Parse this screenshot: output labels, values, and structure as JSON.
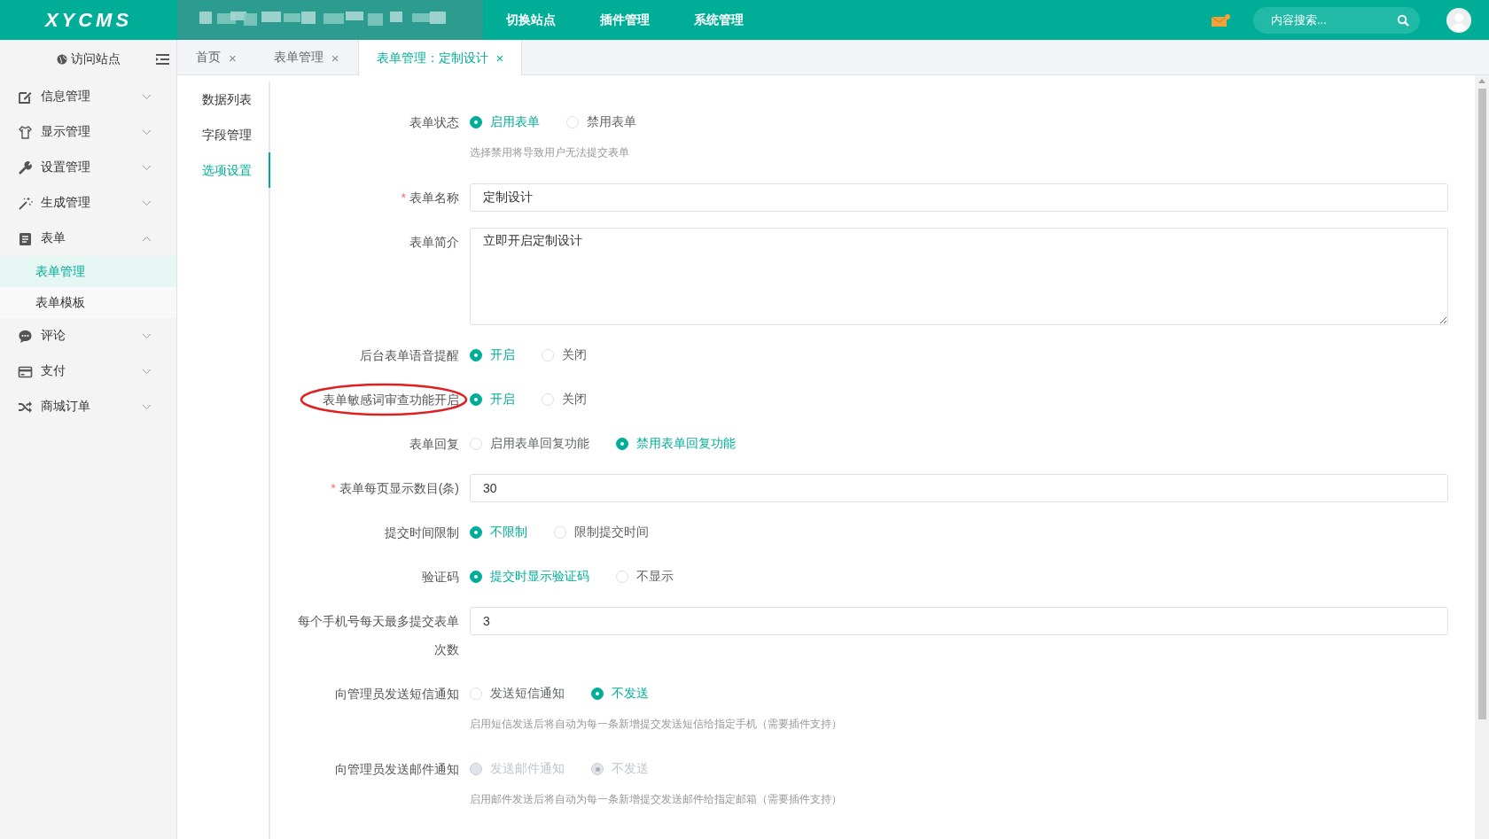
{
  "header": {
    "logo": "XYCMS",
    "nav": [
      {
        "label": "切换站点"
      },
      {
        "label": "插件管理"
      },
      {
        "label": "系统管理"
      }
    ],
    "mail": {
      "unread": true
    },
    "search": {
      "placeholder": "内容搜索..."
    }
  },
  "sidebar": {
    "visit_site": "访问站点",
    "items": [
      {
        "label": "信息管理",
        "expanded": false
      },
      {
        "label": "显示管理",
        "expanded": false
      },
      {
        "label": "设置管理",
        "expanded": false
      },
      {
        "label": "生成管理",
        "expanded": false
      },
      {
        "label": "表单",
        "expanded": true,
        "children": [
          {
            "label": "表单管理",
            "selected": true
          },
          {
            "label": "表单模板",
            "selected": false
          }
        ]
      },
      {
        "label": "评论",
        "expanded": false
      },
      {
        "label": "支付",
        "expanded": false
      },
      {
        "label": "商城订单",
        "expanded": false
      }
    ]
  },
  "tabs": [
    {
      "label": "首页",
      "close": "×",
      "selected": false
    },
    {
      "label": "表单管理",
      "close": "×",
      "selected": false
    },
    {
      "label": "表单管理：定制设计",
      "close": "×",
      "selected": true
    }
  ],
  "subnav": [
    {
      "label": "数据列表",
      "selected": false
    },
    {
      "label": "字段管理",
      "selected": false
    },
    {
      "label": "选项设置",
      "selected": true
    }
  ],
  "form": {
    "fields": [
      {
        "kind": "radio",
        "label": "表单状态",
        "disabled": false,
        "options": [
          {
            "label": "启用表单",
            "selected": true
          },
          {
            "label": "禁用表单",
            "selected": false
          }
        ],
        "hint": "选择禁用将导致用户无法提交表单"
      },
      {
        "kind": "text",
        "label": "表单名称",
        "required_mark": "*",
        "value": "定制设计"
      },
      {
        "kind": "textarea",
        "label": "表单简介",
        "value": "立即开启定制设计"
      },
      {
        "kind": "radio",
        "label": "后台表单语音提醒",
        "disabled": false,
        "options": [
          {
            "label": "开启",
            "selected": true
          },
          {
            "label": "关闭",
            "selected": false
          }
        ]
      },
      {
        "kind": "radio",
        "label": "表单敏感词审查功能开启",
        "annotated": true,
        "disabled": false,
        "options": [
          {
            "label": "开启",
            "selected": true
          },
          {
            "label": "关闭",
            "selected": false
          }
        ]
      },
      {
        "kind": "radio",
        "label": "表单回复",
        "disabled": false,
        "options": [
          {
            "label": "启用表单回复功能",
            "selected": false
          },
          {
            "label": "禁用表单回复功能",
            "selected": true
          }
        ]
      },
      {
        "kind": "text",
        "label": "表单每页显示数目(条)",
        "required_mark": "*",
        "value": "30"
      },
      {
        "kind": "radio",
        "label": "提交时间限制",
        "disabled": false,
        "options": [
          {
            "label": "不限制",
            "selected": true
          },
          {
            "label": "限制提交时间",
            "selected": false
          }
        ]
      },
      {
        "kind": "radio",
        "label": "验证码",
        "disabled": false,
        "options": [
          {
            "label": "提交时显示验证码",
            "selected": true
          },
          {
            "label": "不显示",
            "selected": false
          }
        ]
      },
      {
        "kind": "text",
        "label": "每个手机号每天最多提交表单次数",
        "value": "3"
      },
      {
        "kind": "radio",
        "label": "向管理员发送短信通知",
        "disabled": false,
        "options": [
          {
            "label": "发送短信通知",
            "selected": false
          },
          {
            "label": "不发送",
            "selected": true
          }
        ],
        "hint": "启用短信发送后将自动为每一条新增提交发送短信给指定手机（需要插件支持）"
      },
      {
        "kind": "radio",
        "label": "向管理员发送邮件通知",
        "disabled": true,
        "options": [
          {
            "label": "发送邮件通知",
            "selected": false
          },
          {
            "label": "不发送",
            "selected": true
          }
        ],
        "hint": "启用邮件发送后将自动为每一条新增提交发送邮件给指定邮箱（需要插件支持）"
      }
    ]
  }
}
